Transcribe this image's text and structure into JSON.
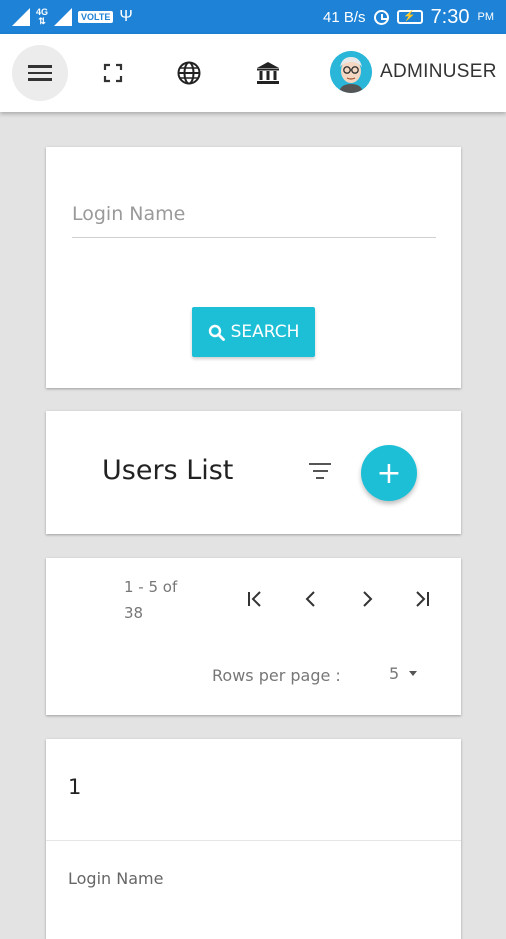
{
  "status_bar": {
    "network_type": "4G",
    "volte": "VOLTE",
    "speed": "41 B/s",
    "time": "7:30",
    "ampm": "PM"
  },
  "toolbar": {
    "username": "ADMINUSER"
  },
  "search_card": {
    "login_name_placeholder": "Login Name",
    "search_button": "SEARCH"
  },
  "users_card": {
    "title": "Users List"
  },
  "pagination": {
    "range": "1 - 5 of 38",
    "rows_per_page_label": "Rows per page :",
    "rows_per_page_value": "5"
  },
  "list": {
    "row_index": "1",
    "field_label": "Login Name"
  },
  "colors": {
    "status_bar": "#1e82d6",
    "accent": "#1cbfd6"
  }
}
